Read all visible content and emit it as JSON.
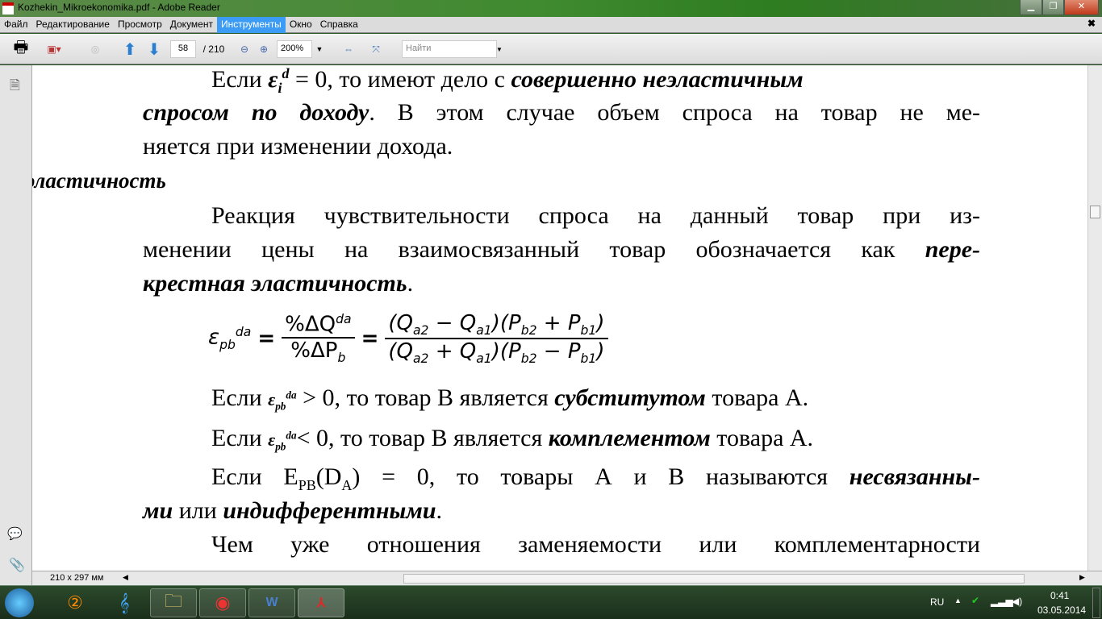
{
  "window": {
    "title": "Kozhekin_Mikroekonomika.pdf - Adobe Reader"
  },
  "menu": [
    "Файл",
    "Редактирование",
    "Просмотр",
    "Документ",
    "Инструменты",
    "Окно",
    "Справка"
  ],
  "toolbar": {
    "page": "58",
    "total": "/ 210",
    "zoom": "200%",
    "search_placeholder": "Найти"
  },
  "doc": {
    "l1a": "Если ",
    "l1b": " = 0, то имеют дело с ",
    "l1c": "совершенно неэластичным",
    "l2a": "спросом по доходу",
    "l2b": ". В этом случае объем спроса на товар не ме-",
    "l3": "няется при изменении дохода.",
    "heading": "эластичность",
    "l4": "Реакция чувствительности спроса на данный товар при из-",
    "l5a": "менении цены на взаимосвязанный товар обозначается как ",
    "l5b": "пере-",
    "l6a": "крестная эластичность",
    "l6b": ".",
    "formula_lhs": "ε",
    "formula_mid_num": "%ΔQ",
    "formula_mid_den": "%ΔP",
    "formula_num": "(Q",
    "formula_den": "(Q",
    "e1a": "Если ",
    "e1b": " > 0, то товар В является ",
    "e1c": "субститутом",
    "e1d": " товара А.",
    "e2a": "Если ",
    "e2b": "< 0, то товар В является ",
    "e2c": "комплементом",
    "e2d": " товара А.",
    "e3a": "Если E",
    "e3b": "PB",
    "e3c": "(D",
    "e3d": "A",
    "e3e": ") = 0, то товары А и В называются ",
    "e3f": "несвязанны-",
    "e4a": "ми",
    "e4b": " или ",
    "e4c": "индифферентными",
    "e4d": ".",
    "l7": "Чем уже отношения заменяемости или комплементарности"
  },
  "status": {
    "page_size": "210 x 297 мм"
  },
  "tray": {
    "lang": "RU",
    "time": "0:41",
    "date": "03.05.2014"
  }
}
